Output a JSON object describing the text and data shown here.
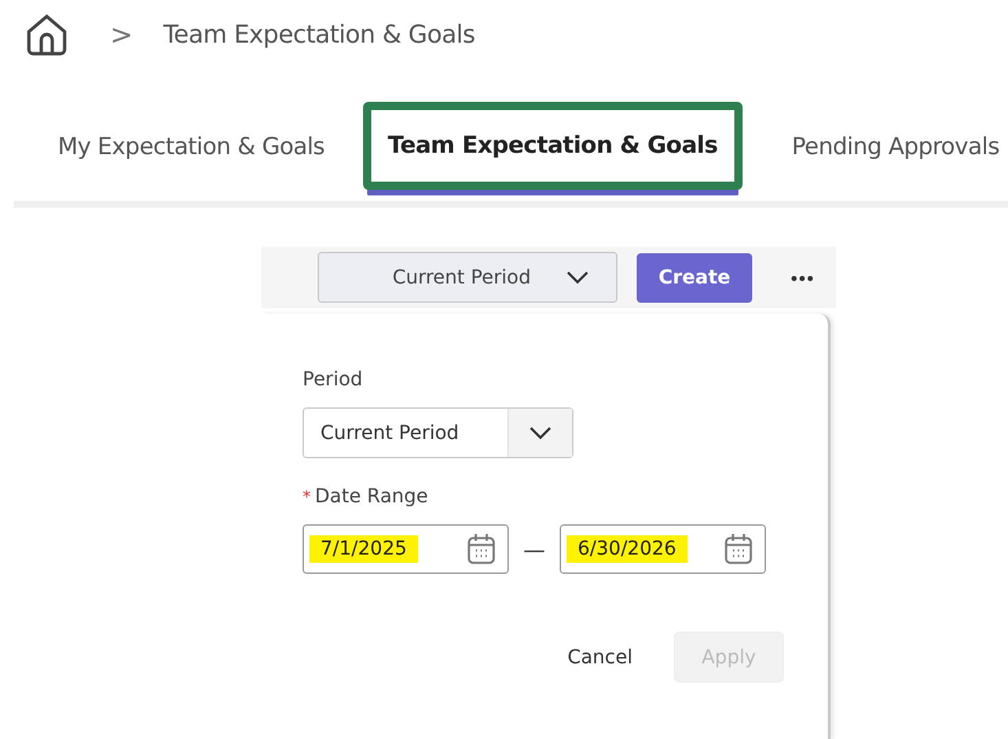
{
  "breadcrumb": {
    "separator": ">",
    "current": "Team Expectation & Goals"
  },
  "tabs": [
    {
      "label": "My Expectation & Goals",
      "selected": false,
      "highlighted": false
    },
    {
      "label": "Team Expectation & Goals",
      "selected": true,
      "highlighted": true
    },
    {
      "label": "Pending Approvals",
      "selected": false,
      "highlighted": false
    }
  ],
  "toolbar": {
    "period_select": "Current Period",
    "create_button": "Create",
    "more_button": "•••"
  },
  "filter_panel": {
    "period_label": "Period",
    "period_value": "Current Period",
    "date_range_label": "Date Range",
    "required_mark": "*",
    "range_separator": "—",
    "dates": [
      {
        "value": "7/1/2025",
        "highlighted": true
      },
      {
        "value": "6/30/2026",
        "highlighted": true
      }
    ],
    "cancel_button": "Cancel",
    "apply_button": {
      "label": "Apply",
      "disabled": true
    }
  }
}
